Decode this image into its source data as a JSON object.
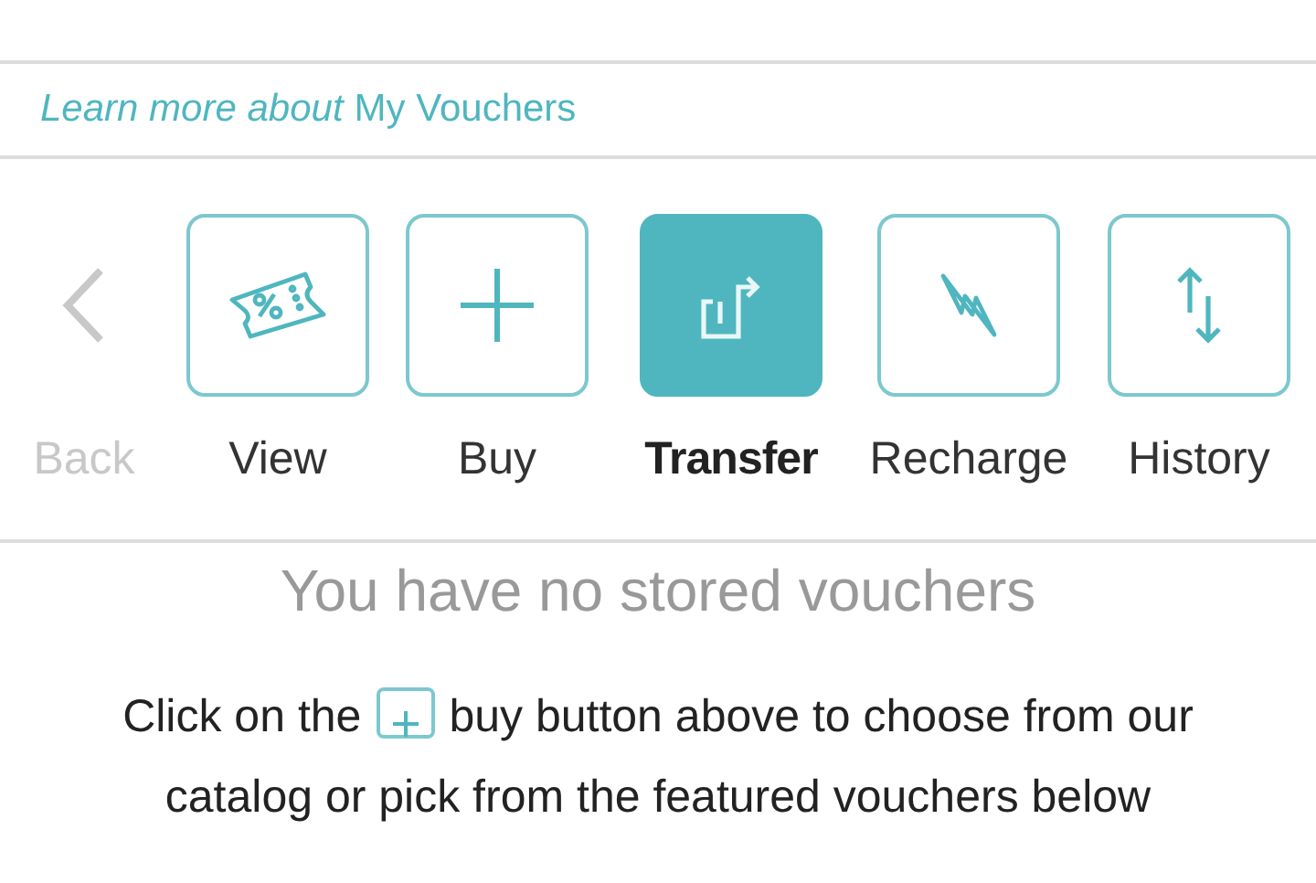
{
  "learn_more": {
    "prefix": "Learn more about",
    "link": "My Vouchers"
  },
  "actions": [
    {
      "kind": "back",
      "label": "Back",
      "selected": false,
      "disabled": true
    },
    {
      "kind": "view",
      "label": "View",
      "selected": false,
      "disabled": false
    },
    {
      "kind": "buy",
      "label": "Buy",
      "selected": false,
      "disabled": false
    },
    {
      "kind": "transfer",
      "label": "Transfer",
      "selected": true,
      "disabled": false
    },
    {
      "kind": "recharge",
      "label": "Recharge",
      "selected": false,
      "disabled": false
    },
    {
      "kind": "history",
      "label": "History",
      "selected": false,
      "disabled": false
    }
  ],
  "empty_title": "You have no stored vouchers",
  "instruction": {
    "before": "Click on the",
    "after_line1": "buy button above to choose from our",
    "line2": "catalog or pick from the featured vouchers below"
  }
}
